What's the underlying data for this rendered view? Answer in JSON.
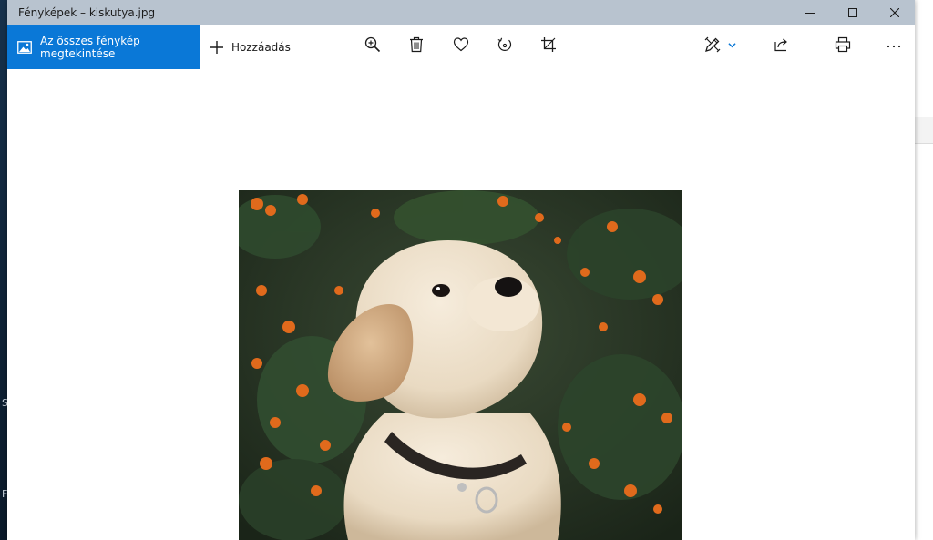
{
  "window": {
    "title": "Fényképek – kiskutya.jpg"
  },
  "toolbar": {
    "view_all_label": "Az összes fénykép megtekintése",
    "add_label": "Hozzáadás",
    "icons": [
      "zoom-in-icon",
      "delete-icon",
      "heart-icon",
      "rotate-icon",
      "crop-icon",
      "edit-pen-icon",
      "chevron-down-icon",
      "share-icon",
      "print-icon",
      "more-icon"
    ]
  },
  "desktop": {
    "letters": [
      "S",
      "F"
    ]
  },
  "colors": {
    "accent": "#0a78d7",
    "titlebar": "#b8c3cf"
  }
}
